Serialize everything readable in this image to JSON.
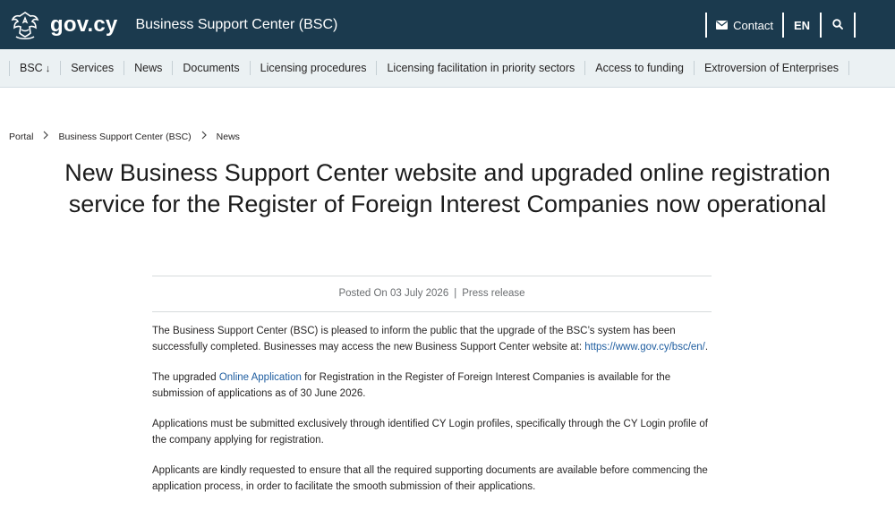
{
  "header": {
    "brand": "gov.cy",
    "site_name": "Business Support Center (BSC)",
    "contact_label": "Contact",
    "language_label": "EN",
    "icons": [
      "cyprus-emblem-icon",
      "mail-icon",
      "search-icon"
    ],
    "background_color": "#1b3a4e"
  },
  "nav": {
    "items": [
      {
        "label": "BSC",
        "icon": "arrow-down-icon"
      },
      {
        "label": "Services"
      },
      {
        "label": "News"
      },
      {
        "label": "Documents"
      },
      {
        "label": "Licensing procedures"
      },
      {
        "label": "Licensing facilitation in priority sectors"
      },
      {
        "label": "Access to funding"
      },
      {
        "label": "Extroversion of Enterprises"
      }
    ],
    "background_color": "#ebf1f3"
  },
  "breadcrumb": {
    "items": [
      "Portal",
      "Business Support Center (BSC)",
      "News"
    ],
    "separator_icon": "chevron-right-icon"
  },
  "article": {
    "title": "New Business Support Center website and upgraded online registration service for the Register of Foreign Interest Companies now operational",
    "meta": {
      "posted": "Posted On 03 July 2026",
      "separator": "|",
      "type": "Press release"
    },
    "paragraphs": [
      {
        "before": "The Business Support Center (BSC) is pleased to inform the public that the upgrade of the BSC’s system has been successfully completed. Businesses may access the new Business Support Center website at: ",
        "link": "https://www.gov.cy/bsc/en/",
        "after": "."
      },
      {
        "before": "The upgraded ",
        "link": "Online Application",
        "after": " for Registration in the Register of Foreign Interest Companies is available for the submission of applications as of 30 June 2026."
      },
      {
        "text": "Applications must be submitted exclusively through identified CY Login profiles, specifically through the CY Login profile of the company applying for registration."
      },
      {
        "text": "Applicants are kindly requested to ensure that all the required supporting documents are available before commencing the application process, in order to facilitate the smooth submission of their applications."
      }
    ],
    "link_color": "#1d5c9f"
  }
}
